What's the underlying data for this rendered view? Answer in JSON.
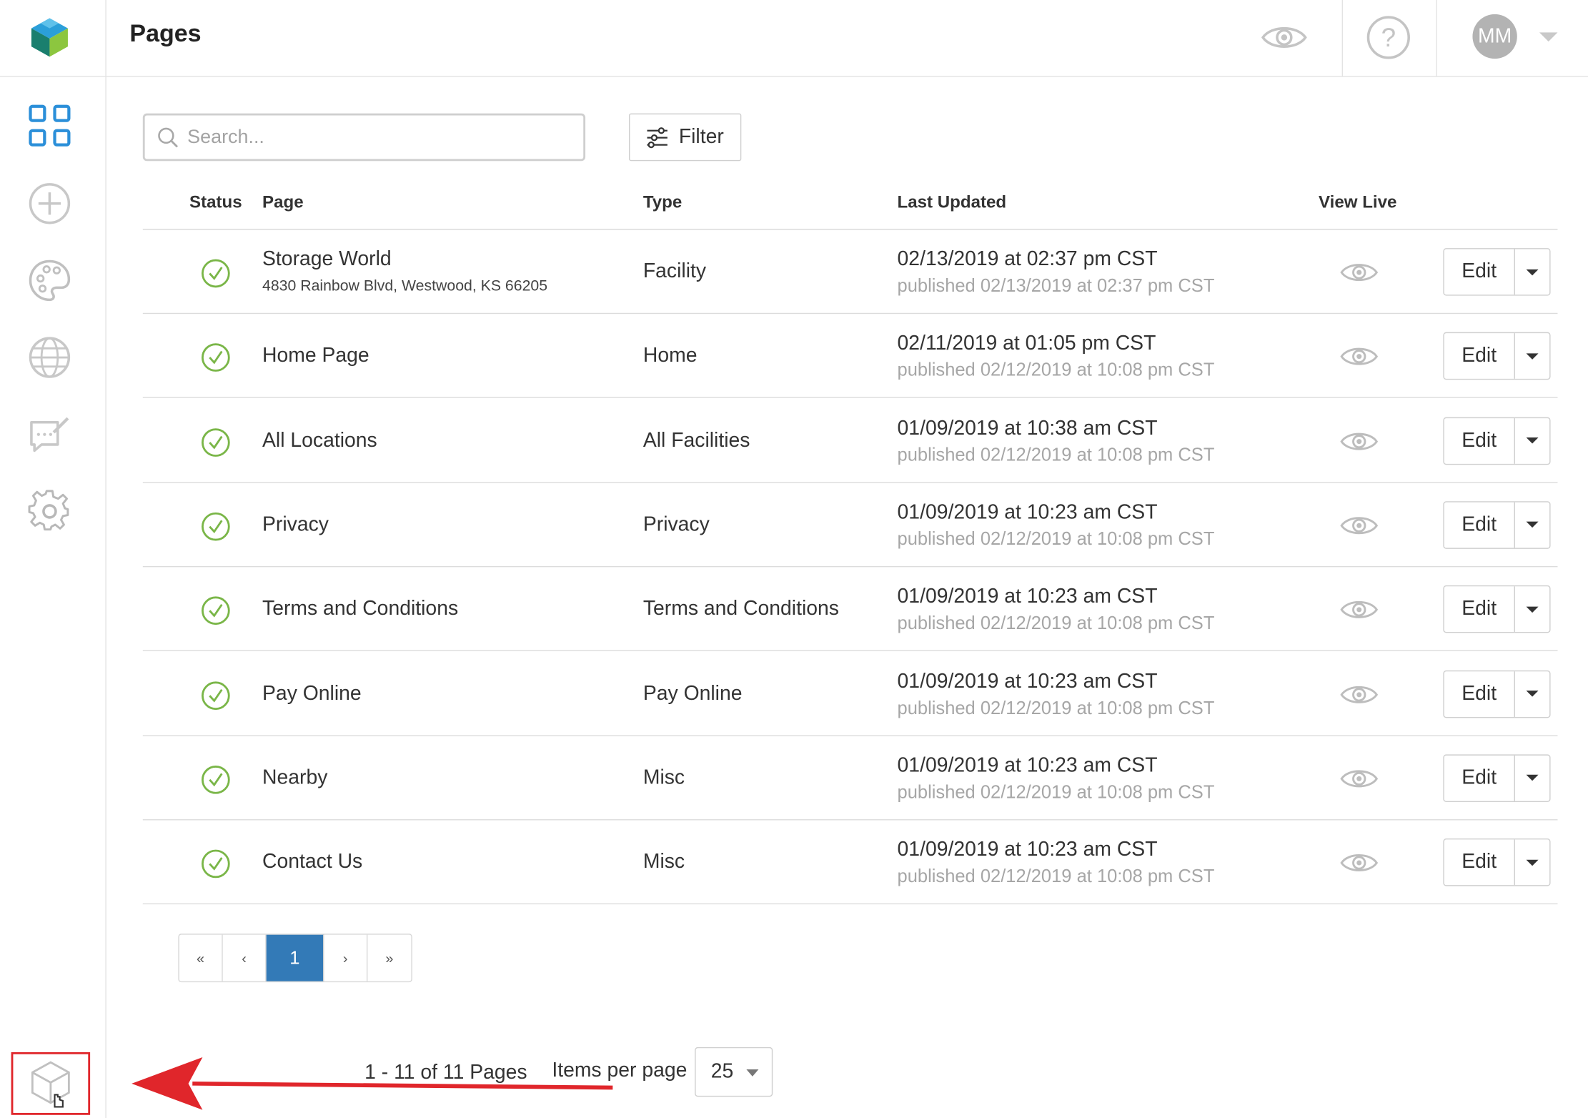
{
  "header": {
    "title": "Pages",
    "avatar_initials": "MM"
  },
  "sidebar": {
    "items": [
      {
        "name": "dashboard-grid-icon",
        "active": true
      },
      {
        "name": "add-circle-icon"
      },
      {
        "name": "palette-icon"
      },
      {
        "name": "globe-icon"
      },
      {
        "name": "chat-edit-icon"
      },
      {
        "name": "gear-icon"
      },
      {
        "name": "cube-icon"
      }
    ]
  },
  "toolbar": {
    "search_placeholder": "Search...",
    "filter_label": "Filter"
  },
  "table": {
    "columns": {
      "status": "Status",
      "page": "Page",
      "type": "Type",
      "last_updated": "Last Updated",
      "view_live": "View Live"
    },
    "edit_label": "Edit",
    "rows": [
      {
        "page": "Storage World",
        "address": "4830 Rainbow Blvd, Westwood, KS 66205",
        "type": "Facility",
        "updated": "02/13/2019 at 02:37 pm CST",
        "published": "published 02/13/2019 at 02:37 pm CST"
      },
      {
        "page": "Home Page",
        "address": "",
        "type": "Home",
        "updated": "02/11/2019 at 01:05 pm CST",
        "published": "published 02/12/2019 at 10:08 pm CST"
      },
      {
        "page": "All Locations",
        "address": "",
        "type": "All Facilities",
        "updated": "01/09/2019 at 10:38 am CST",
        "published": "published 02/12/2019 at 10:08 pm CST"
      },
      {
        "page": "Privacy",
        "address": "",
        "type": "Privacy",
        "updated": "01/09/2019 at 10:23 am CST",
        "published": "published 02/12/2019 at 10:08 pm CST"
      },
      {
        "page": "Terms and Conditions",
        "address": "",
        "type": "Terms and Conditions",
        "updated": "01/09/2019 at 10:23 am CST",
        "published": "published 02/12/2019 at 10:08 pm CST"
      },
      {
        "page": "Pay Online",
        "address": "",
        "type": "Pay Online",
        "updated": "01/09/2019 at 10:23 am CST",
        "published": "published 02/12/2019 at 10:08 pm CST"
      },
      {
        "page": "Nearby",
        "address": "",
        "type": "Misc",
        "updated": "01/09/2019 at 10:23 am CST",
        "published": "published 02/12/2019 at 10:08 pm CST"
      },
      {
        "page": "Contact Us",
        "address": "",
        "type": "Misc",
        "updated": "01/09/2019 at 10:23 am CST",
        "published": "published 02/12/2019 at 10:08 pm CST"
      }
    ]
  },
  "pagination": {
    "first": "«",
    "prev": "‹",
    "current": "1",
    "next": "›",
    "last": "»",
    "count_text": "1 - 11 of 11 Pages",
    "items_per_page_label": "Items per page",
    "items_per_page_value": "25"
  },
  "colors": {
    "accent": "#337ab7",
    "status_ok": "#7ab648",
    "highlight": "#e0262b"
  }
}
